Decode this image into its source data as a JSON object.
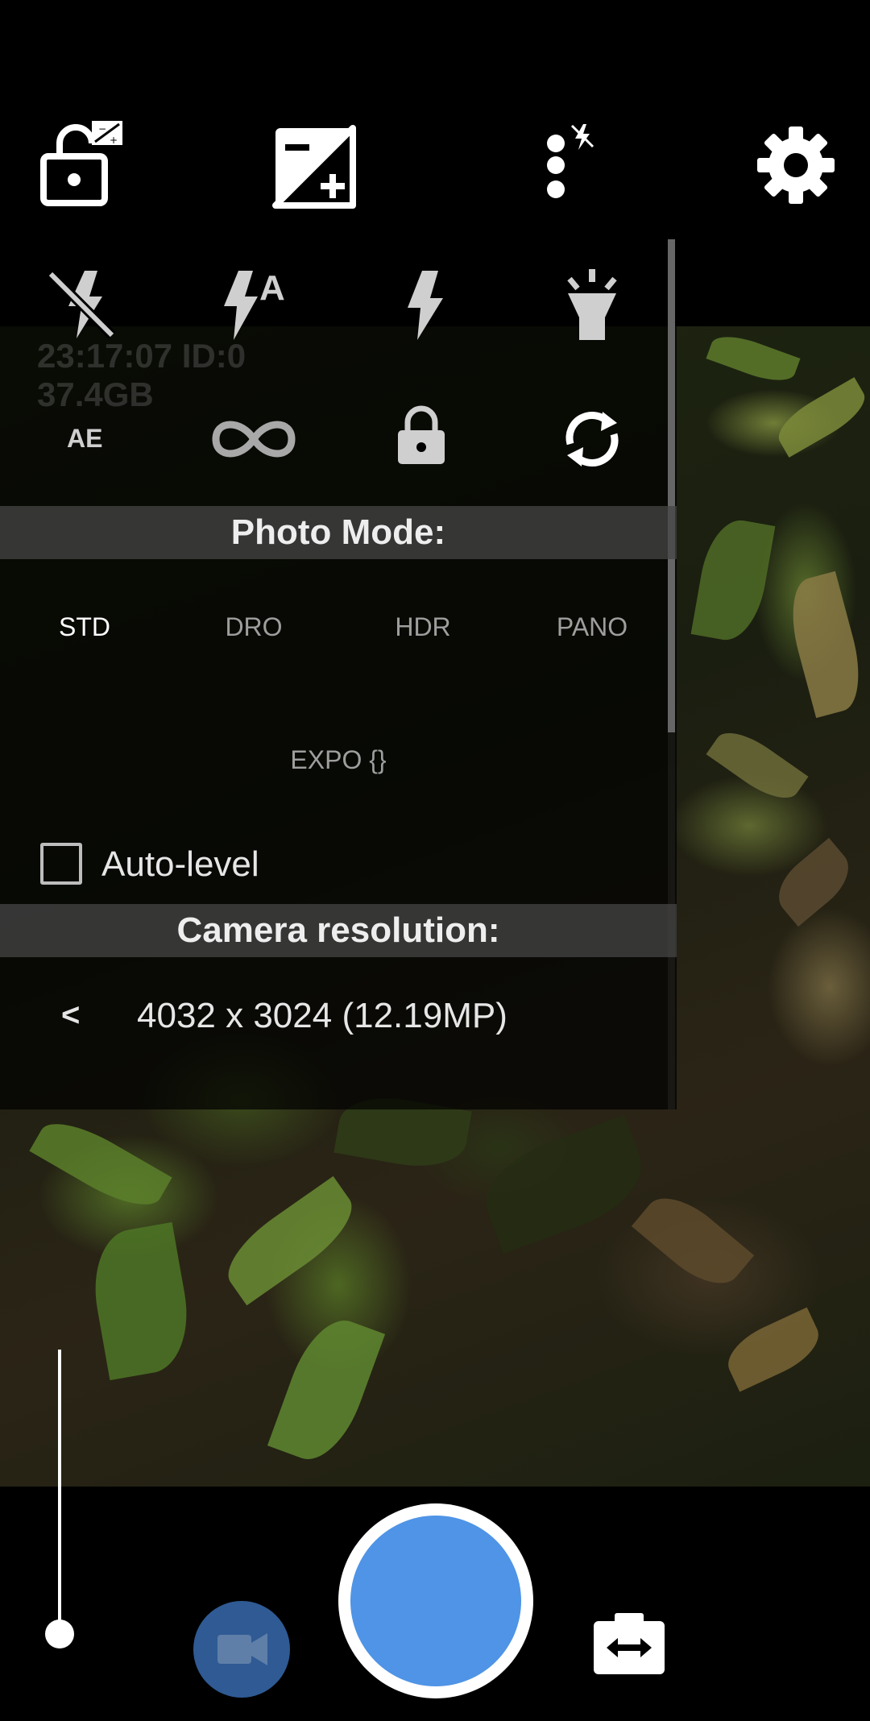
{
  "osd": {
    "time": "23:17:07",
    "id": "ID:0",
    "storage": "37.4GB"
  },
  "icons": {
    "top": [
      "lock-open-icon",
      "exposure-compensation-icon",
      "popup-menu-icon",
      "settings-gear-icon"
    ],
    "flash": [
      "flash-off-icon",
      "flash-auto-icon",
      "flash-on-icon",
      "torch-icon"
    ],
    "row2": [
      "ae-icon",
      "infinity-focus-icon",
      "exposure-lock-icon",
      "white-balance-lock-icon"
    ]
  },
  "labels": {
    "ae": "AE",
    "flash_auto_letter": "A"
  },
  "photo_mode": {
    "header": "Photo Mode:",
    "modes": [
      "STD",
      "DRO",
      "HDR",
      "PANO"
    ],
    "extra_mode": "EXPO {}",
    "selected": "STD"
  },
  "auto_level": {
    "label": "Auto-level",
    "checked": false
  },
  "camera_resolution": {
    "header": "Camera resolution:",
    "prev": "<",
    "value": "4032 x 3024 (12.19MP)"
  },
  "colors": {
    "shutter": "#4f94e6",
    "video_button": "#2f5a94",
    "popup_bg": "rgba(0,0,0,0.70)"
  }
}
